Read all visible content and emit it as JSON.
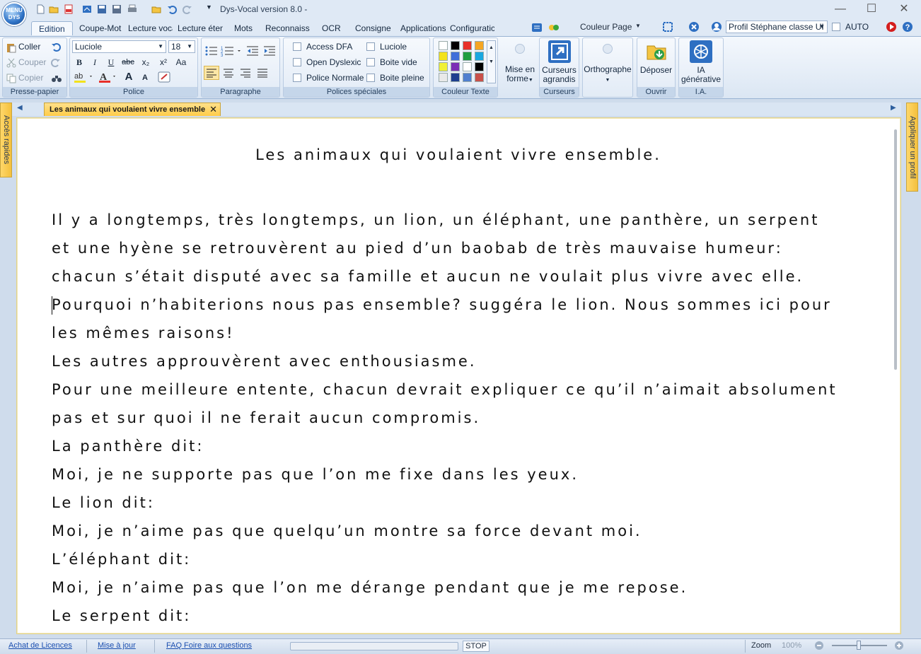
{
  "window": {
    "logo_text": "MENU DYS",
    "title": "Dys-Vocal version 8.0  -",
    "minimize": "—",
    "maximize": "☐",
    "close": "✕"
  },
  "tabs": [
    "Edition",
    "Coupe-Mot",
    "Lecture voca",
    "Lecture éten",
    "Mots",
    "Reconnaiss",
    "OCR",
    "Consigne",
    "Applications",
    "Configuratic"
  ],
  "tab_right": {
    "couleur_page": "Couleur Page",
    "profile": "Profil Stéphane classe UI",
    "auto": "AUTO"
  },
  "ribbon": {
    "presse_papier": {
      "label": "Presse-papier",
      "coller": "Coller",
      "couper": "Couper",
      "copier": "Copier"
    },
    "police": {
      "label": "Police",
      "font": "Luciole",
      "size": "18",
      "bold": "B",
      "italic": "I",
      "underline": "U",
      "strike": "abc",
      "sub": "x₂",
      "sup": "x²",
      "case": "Aa",
      "grow": "A",
      "shrink": "A"
    },
    "paragraphe": {
      "label": "Paragraphe"
    },
    "polices_speciales": {
      "label": "Polices spéciales",
      "access_dfa": "Access DFA",
      "open_dyslexic": "Open Dyslexic",
      "police_normale": "Police Normale",
      "luciole": "Luciole",
      "boite_vide": "Boite vide",
      "boite_pleine": "Boite pleine"
    },
    "couleur_texte": {
      "label": "Couleur Texte"
    },
    "mise_en_forme": "Mise en forme",
    "curseurs": {
      "label": "Curseurs",
      "button": "Curseurs agrandis"
    },
    "orthographe": "Orthographe",
    "ouvrir": {
      "label": "Ouvrir",
      "button": "Déposer"
    },
    "ia": {
      "label": "I.A.",
      "button": "IA générative"
    }
  },
  "colors": [
    "#ffffff",
    "#000000",
    "#e8312a",
    "#f5a623",
    "#f3e21b",
    "#3f6fd9",
    "#1f9e3f",
    "#19a7e0",
    "#f0f036",
    "#7b2fb5",
    "#ffffff",
    "#000000",
    "#e9e9e9",
    "#1e3f8f",
    "#4f7fcf",
    "#c8504a"
  ],
  "side_left": "Accès rapides",
  "side_right": "Appliquer un profil",
  "document": {
    "tab_title": "Les animaux qui voulaient vivre ensemble",
    "title": "Les animaux qui voulaient vivre ensemble.",
    "lines": [
      "Il y a longtemps, très longtemps, un lion, un éléphant, une panthère, un serpent",
      "et une hyène se retrouvèrent au pied d’un baobab de très mauvaise humeur:",
      "chacun s’était disputé avec sa famille et aucun ne voulait plus vivre avec elle.",
      "Pourquoi n’habiterions nous pas ensemble? suggéra le lion. Nous sommes ici pour",
      "les mêmes raisons!",
      "Les autres approuvèrent avec enthousiasme.",
      "Pour une meilleure entente, chacun devrait expliquer ce qu’il n’aimait absolument",
      "pas et sur quoi il ne ferait aucun compromis.",
      "La panthère dit:",
      " Moi, je ne supporte pas que l’on me fixe dans les yeux.",
      "Le lion dit:",
      " Moi, je n’aime pas que quelqu’un montre sa force devant moi.",
      "L’éléphant dit:",
      " Moi, je n’aime pas que l’on me dérange pendant que je me repose.",
      "Le serpent dit:"
    ]
  },
  "status": {
    "achat": "Achat de Licences",
    "mise_a_jour": "Mise à jour",
    "faq": "FAQ Foire aux questions",
    "stop": "STOP",
    "zoom_label": "Zoom",
    "zoom_value": "100%"
  }
}
